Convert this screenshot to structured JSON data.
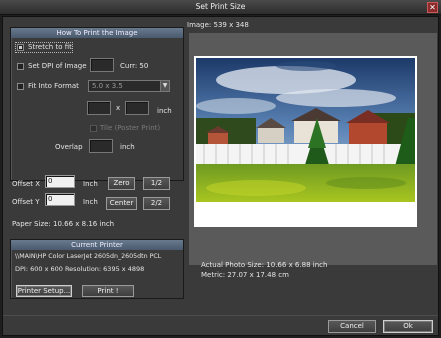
{
  "window": {
    "title": "Set Print Size",
    "close_glyph": "✕"
  },
  "how_to_print": {
    "header": "How To Print the Image",
    "stretch_label": "Stretch to fit",
    "dpi_label": "Set DPI of Image",
    "dpi_value": "",
    "dpi_current": "Curr: 50",
    "fit_format_label": "Fit Into Format",
    "format_value": "5.0 x 3.5",
    "format_width": "",
    "format_x": "x",
    "format_height": "",
    "format_unit": "inch",
    "tile_label": "Tile (Poster Print)",
    "overlap_label": "Overlap",
    "overlap_value": "",
    "overlap_unit": "inch"
  },
  "offsets": {
    "x_label": "Offset X",
    "x_value": "0",
    "x_unit": "Inch",
    "y_label": "Offset Y",
    "y_value": "0",
    "y_unit": "Inch",
    "zero_button": "Zero",
    "half_button": "1/2",
    "center_button": "Center",
    "two_button": "2/2",
    "paper_size": "Paper Size: 10.66 x 8.16 inch"
  },
  "printer": {
    "header": "Current Printer",
    "name": "\\\\MAIN\\HP Color LaserJet 2605dn_2605dtn PCL",
    "dpi_info": "DPI: 600 x 600  Resolution: 6395 x 4898",
    "setup_button": "Printer Setup...",
    "print_button": "Print !"
  },
  "preview": {
    "image_size": "Image: 539 x 348",
    "actual_size": "Actual Photo Size: 10.66 x 6.88 inch",
    "metric": "Metric: 27.07 x 17.48 cm"
  },
  "footer": {
    "cancel_button": "Cancel",
    "ok_button": "Ok"
  },
  "colors": {
    "header_blue": "#5a6a7e",
    "dialog_bg": "#3a3a3a",
    "paper": "#ffffff"
  }
}
